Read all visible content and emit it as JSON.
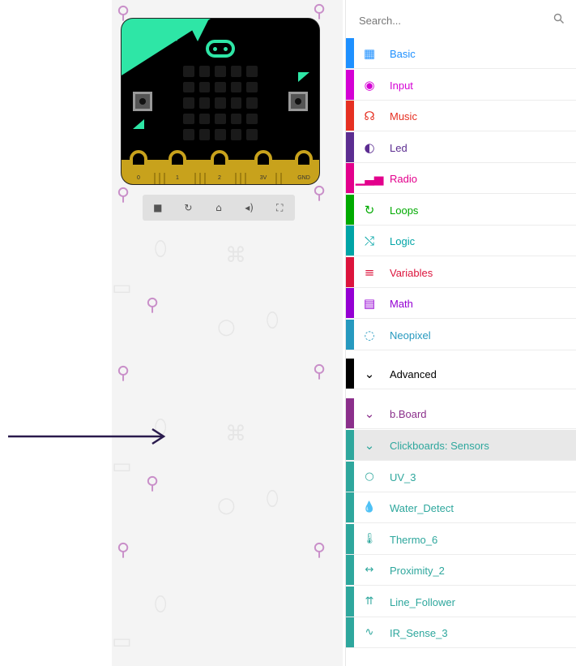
{
  "search": {
    "placeholder": "Search..."
  },
  "colors": {
    "board_accent": "#2ee6a6",
    "board_gold": "#c8a21c",
    "arrow": "#2a1b4d"
  },
  "simulator": {
    "pin_labels": [
      "0",
      "1",
      "2",
      "3V",
      "GND"
    ],
    "toolbar_icons": [
      "stop-icon",
      "restart-icon",
      "debug-icon",
      "mute-icon",
      "fullscreen-icon"
    ]
  },
  "categories": [
    {
      "label": "Basic",
      "color": "#1e90ff",
      "icon": "grid-icon",
      "glyph": "▦"
    },
    {
      "label": "Input",
      "color": "#d400d4",
      "icon": "target-icon",
      "glyph": "◉"
    },
    {
      "label": "Music",
      "color": "#e63022",
      "icon": "headphones-icon",
      "glyph": "☊"
    },
    {
      "label": "Led",
      "color": "#5c2d91",
      "icon": "toggle-icon",
      "glyph": "◐"
    },
    {
      "label": "Radio",
      "color": "#e3008c",
      "icon": "signal-bars-icon",
      "glyph": "▁▃▅"
    },
    {
      "label": "Loops",
      "color": "#00aa00",
      "icon": "loop-arrow-icon",
      "glyph": "↻"
    },
    {
      "label": "Logic",
      "color": "#00a4a6",
      "icon": "shuffle-icon",
      "glyph": "⤭"
    },
    {
      "label": "Variables",
      "color": "#dc143c",
      "icon": "lines-icon",
      "glyph": "≡"
    },
    {
      "label": "Math",
      "color": "#9400d3",
      "icon": "calculator-icon",
      "glyph": "▤"
    },
    {
      "label": "Neopixel",
      "color": "#2699bf",
      "icon": "dotted-circle-icon",
      "glyph": "◌"
    }
  ],
  "advanced": {
    "label": "Advanced",
    "color": "#000000"
  },
  "bboard": {
    "label": "b.Board",
    "color": "#8b2f8b"
  },
  "clickboards": {
    "label": "Clickboards: Sensors",
    "color": "#2ea79d"
  },
  "sensors": [
    {
      "label": "UV_3",
      "icon": "sun-outline-icon",
      "glyph": "○"
    },
    {
      "label": "Water_Detect",
      "icon": "water-drop-icon",
      "glyph": "💧"
    },
    {
      "label": "Thermo_6",
      "icon": "thermometer-icon",
      "glyph": "🌡"
    },
    {
      "label": "Proximity_2",
      "icon": "double-arrow-icon",
      "glyph": "↔"
    },
    {
      "label": "Line_Follower",
      "icon": "up-arrows-icon",
      "glyph": "⇈"
    },
    {
      "label": "IR_Sense_3",
      "icon": "wave-icon",
      "glyph": "∿"
    }
  ]
}
